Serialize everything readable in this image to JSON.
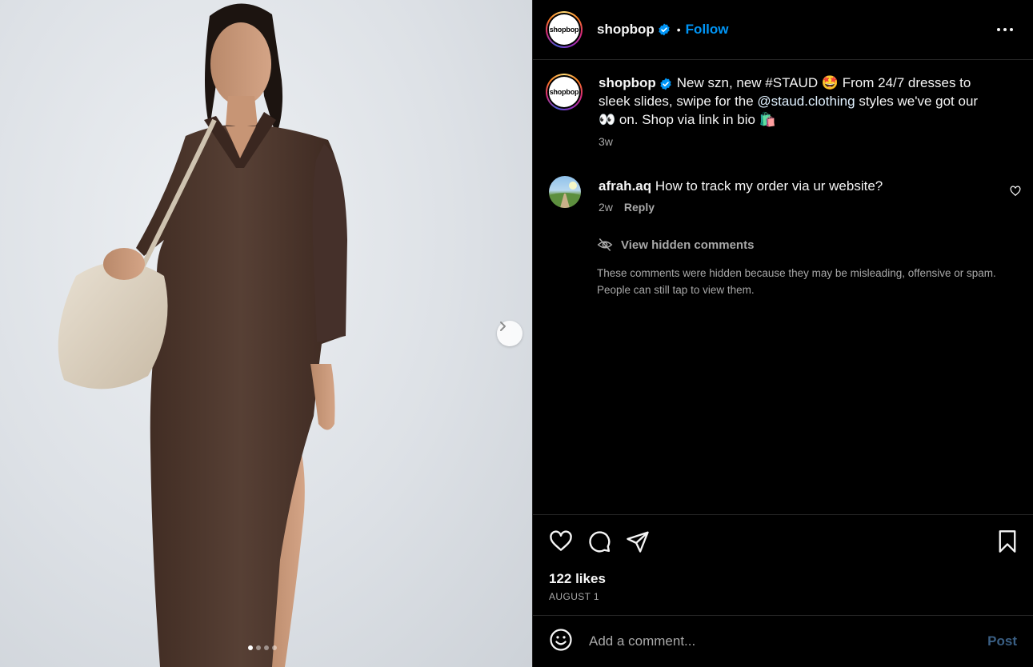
{
  "post": {
    "username": "shopbop",
    "avatar_text": "shopbop",
    "verified": true,
    "separator": "•",
    "follow_label": "Follow",
    "more_icon": "more-horizontal-icon"
  },
  "caption": {
    "username": "shopbop",
    "text_1": "New szn, new #STAUD 🤩 From 24/7 dresses to sleek slides, swipe for the ",
    "mention": "@staud.clothing",
    "text_2": " styles we've got our 👀 on. Shop via link in bio 🛍️",
    "age": "3w"
  },
  "comments": [
    {
      "username": "afrah.aq",
      "text": "How to track my order via ur website?",
      "age": "2w",
      "reply_label": "Reply"
    }
  ],
  "hidden_comments": {
    "link_label": "View hidden comments",
    "note": "These comments were hidden because they may be misleading, offensive or spam. People can still tap to view them."
  },
  "engagement": {
    "likes": "122 likes",
    "date": "AUGUST 1"
  },
  "composer": {
    "placeholder": "Add a comment...",
    "post_label": "Post"
  },
  "carousel": {
    "total_slides": 4,
    "active_slide": 1
  },
  "colors": {
    "background": "#000000",
    "accent": "#0095f6",
    "muted_text": "#a8a8a8",
    "divider": "#262626",
    "dress": "#4a3228"
  }
}
